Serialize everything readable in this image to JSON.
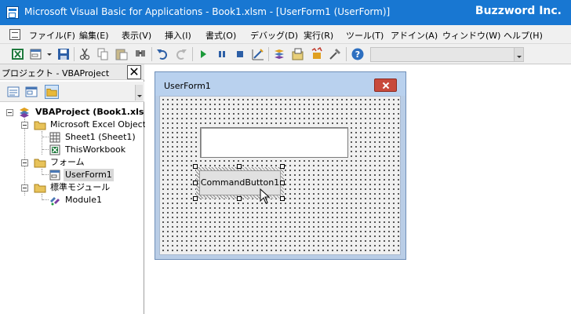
{
  "window": {
    "title": "Microsoft Visual Basic for Applications - Book1.xlsm - [UserForm1 (UserForm)]",
    "brand": "Buzzword Inc."
  },
  "menu": {
    "items": [
      "ファイル(F)",
      "編集(E)",
      "表示(V)",
      "挿入(I)",
      "書式(O)",
      "デバッグ(D)",
      "実行(R)",
      "ツール(T)",
      "アドイン(A)",
      "ウィンドウ(W)",
      "ヘルプ(H)"
    ]
  },
  "toolbar": {
    "icons": [
      "excel-view-icon",
      "insert-userform-icon",
      "save-icon",
      "cut-icon",
      "copy-icon",
      "paste-icon",
      "find-icon",
      "undo-icon",
      "redo-icon",
      "run-icon",
      "break-icon",
      "reset-icon",
      "design-mode-icon",
      "project-explorer-icon",
      "properties-icon",
      "object-browser-icon",
      "toolbox-icon",
      "help-icon"
    ]
  },
  "explorer": {
    "title": "プロジェクト - VBAProject",
    "close_glyph": "✕",
    "tree": {
      "project": "VBAProject (Book1.xls",
      "excel_objects": "Microsoft Excel Object",
      "sheet1": "Sheet1 (Sheet1)",
      "thisworkbook": "ThisWorkbook",
      "forms": "フォーム",
      "userform1": "UserForm1",
      "modules": "標準モジュール",
      "module1": "Module1"
    }
  },
  "userform": {
    "title": "UserForm1",
    "button_label": "CommandButton1"
  },
  "colors": {
    "title_bar": "#1877d2",
    "form_frame": "#b9cde6",
    "close_button": "#c84a3c"
  }
}
